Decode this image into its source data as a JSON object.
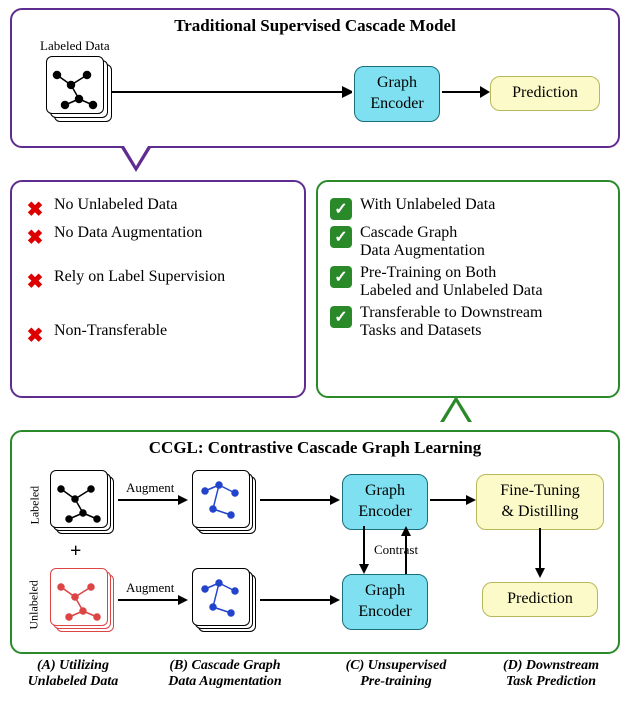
{
  "top": {
    "title": "Traditional Supervised Cascade Model",
    "data_label": "Labeled Data",
    "encoder": "Graph\nEncoder",
    "prediction": "Prediction"
  },
  "cons": [
    "No Unlabeled Data",
    "No Data Augmentation",
    "Rely on Label Supervision",
    "Non-Transferable"
  ],
  "pros": [
    "With Unlabeled Data",
    "Cascade Graph\nData Augmentation",
    "Pre-Training on Both\nLabeled and Unlabeled Data",
    "Transferable to Downstream\nTasks and Datasets"
  ],
  "bottom": {
    "title": "CCGL: Contrastive Cascade Graph Learning",
    "labeled": "Labeled",
    "unlabeled": "Unlabeled",
    "plus": "+",
    "augment": "Augment",
    "contrast": "Contrast",
    "encoder": "Graph\nEncoder",
    "fine": "Fine-Tuning\n& Distilling",
    "prediction": "Prediction",
    "captions": {
      "a": "(A) Utilizing\nUnlabeled Data",
      "b": "(B) Cascade Graph\nData Augmentation",
      "c": "(C) Unsupervised\nPre-training",
      "d": "(D) Downstream\nTask Prediction"
    }
  }
}
